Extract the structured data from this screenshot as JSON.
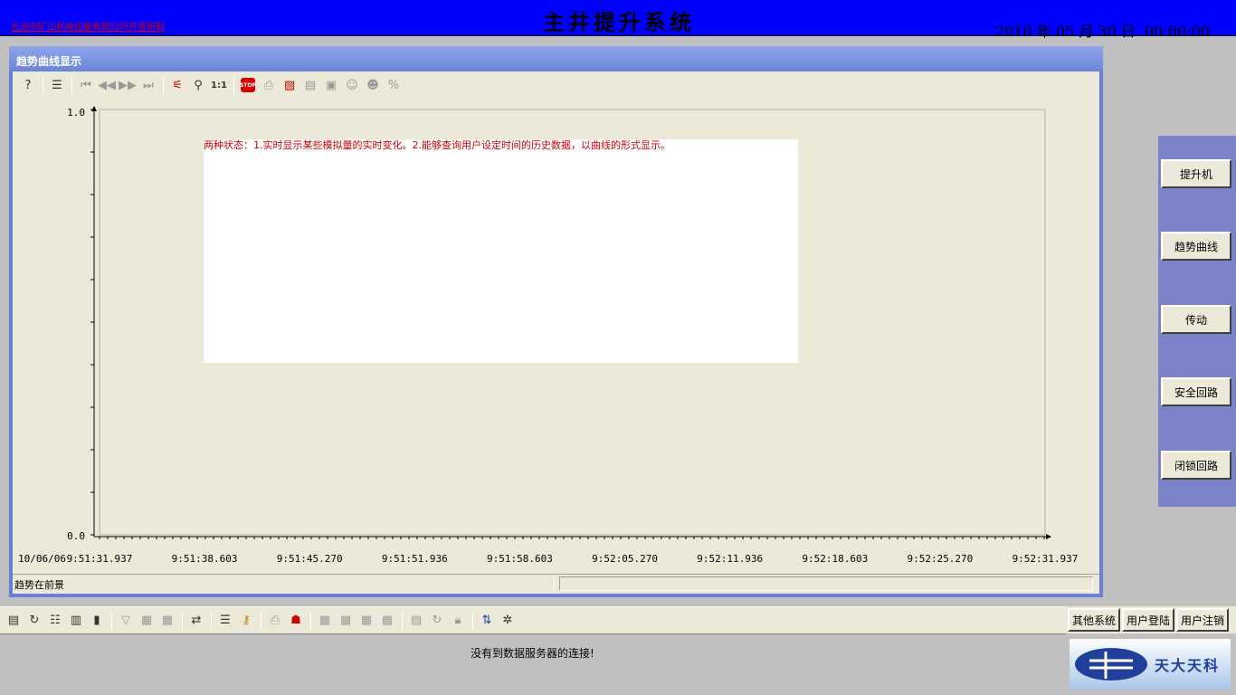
{
  "header": {
    "company": "长治市矿山机电设备有限公司开发研制",
    "title": "主井提升系统",
    "datetime": "2010 年 05 月 30 日  00:00:00"
  },
  "trend_window": {
    "title": "趋势曲线显示",
    "toolbar_icons": [
      "help-icon",
      "list-icon",
      "first-icon",
      "prev-icon",
      "next-icon",
      "last-icon",
      "zoom-tool-icon",
      "magnifier-icon",
      "one-to-one-icon",
      "stop-icon",
      "print-icon",
      "chart-icon",
      "copy-icon",
      "save-icon",
      "user-icon",
      "user2-icon",
      "percent-icon"
    ],
    "one_to_one_label": "1:1",
    "stop_label": "STOP",
    "percent_label": "%",
    "annotation": "两种状态：1.实时显示某些模拟量的实时变化。2.能够查询用户设定时间的历史数据，以曲线的形式显示。",
    "status_text": "趋势在前景"
  },
  "chart_data": {
    "type": "line",
    "ylim": [
      0.0,
      1.0
    ],
    "y_ticks": [
      "1.0",
      "0.0"
    ],
    "date_label": "10/06/06",
    "x_ticks": [
      "9:51:31.937",
      "9:51:38.603",
      "9:51:45.270",
      "9:51:51.936",
      "9:51:58.603",
      "9:52:05.270",
      "9:52:11.936",
      "9:52:18.603",
      "9:52:25.270",
      "9:52:31.937"
    ],
    "series": []
  },
  "nav": {
    "items": [
      {
        "label": "提升机"
      },
      {
        "label": "趋势曲线"
      },
      {
        "label": "传动"
      },
      {
        "label": "安全回路"
      },
      {
        "label": "闭锁回路"
      }
    ]
  },
  "bottom": {
    "message": "没有到数据服务器的连接!",
    "buttons": {
      "other_systems": "其他系统",
      "login": "用户登陆",
      "logout": "用户注销"
    },
    "logo_text": "天大天科"
  },
  "colors": {
    "header_bg": "#0000ff",
    "nav_bg": "#7b82c8",
    "window_frame": "#6a7fd4",
    "annotation_text": "#cc0000"
  }
}
